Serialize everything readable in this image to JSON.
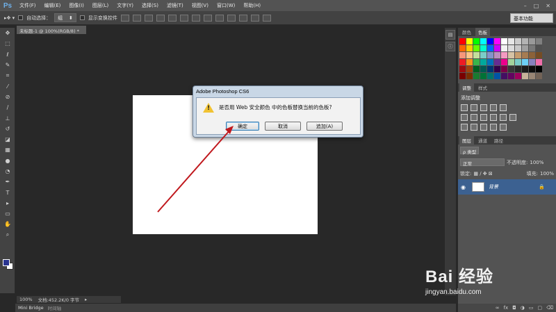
{
  "app": {
    "logo": "Ps"
  },
  "menubar": {
    "items": [
      "文件(F)",
      "编辑(E)",
      "图像(I)",
      "图层(L)",
      "文字(Y)",
      "选择(S)",
      "滤镜(T)",
      "视图(V)",
      "窗口(W)",
      "帮助(H)"
    ],
    "window_controls": [
      "–",
      "□",
      "✕"
    ]
  },
  "options": {
    "auto_select_label": "自动选择：",
    "group_value": "组",
    "show_transform_label": "显示变换控件",
    "workspace": "基本功能"
  },
  "document": {
    "tab_title": "未标题-1 @ 100%(RGB/8) *",
    "zoom": "100%",
    "doc_info": "文档:452.2K/0 字节"
  },
  "bottom_tabs": [
    "Mini Bridge",
    "时间轴"
  ],
  "panels": {
    "color_tabs": [
      "颜色",
      "色板"
    ],
    "adjust_tabs": [
      "调整",
      "样式"
    ],
    "adjust_title": "添加调整",
    "layers_tabs": [
      "图层",
      "通道",
      "路径"
    ],
    "filter_type": "ρ 类型",
    "blend_mode": "正常",
    "opacity_label": "不透明度:",
    "opacity_value": "100%",
    "lock_label": "锁定:",
    "fill_label": "填充:",
    "fill_value": "100%",
    "layer_name": "背景"
  },
  "swatch_colors": [
    "#ff0000",
    "#ffff00",
    "#00ff00",
    "#00ffff",
    "#0000ff",
    "#ff00ff",
    "#ffffff",
    "#e6e6e6",
    "#cccccc",
    "#b3b3b3",
    "#999999",
    "#808080",
    "#ff6600",
    "#ffcc00",
    "#66ff00",
    "#00ffcc",
    "#0066ff",
    "#cc00ff",
    "#f2f2f2",
    "#dcdcdc",
    "#c8c8c8",
    "#a0a0a0",
    "#787878",
    "#505050",
    "#f7977a",
    "#fdc68a",
    "#c4df9b",
    "#7bcdc8",
    "#8493ca",
    "#bc8dbf",
    "#f49ac2",
    "#d6c3a5",
    "#c69c6d",
    "#a67c52",
    "#8c6239",
    "#754c24",
    "#ed1c24",
    "#f7941d",
    "#39b54a",
    "#00a99d",
    "#0072bc",
    "#662d91",
    "#ec008c",
    "#a3d39c",
    "#7accc8",
    "#6dcff6",
    "#8781bd",
    "#f06eaa",
    "#9e0b0f",
    "#a0410d",
    "#005e20",
    "#005952",
    "#003471",
    "#32004b",
    "#7b0046",
    "#363636",
    "#262626",
    "#1a1a1a",
    "#0d0d0d",
    "#000000",
    "#790000",
    "#7b2e00",
    "#197b30",
    "#007236",
    "#00746b",
    "#0054a6",
    "#440e62",
    "#630460",
    "#9e005d",
    "#c7b299",
    "#998675",
    "#736357"
  ],
  "dialog": {
    "title": "Adobe Photoshop CS6",
    "message": "是否用 Web 安全颜色 中的色板替换当前的色板?",
    "buttons": {
      "ok": "确定",
      "cancel": "取消",
      "append": "追加(A)"
    },
    "icon": "warning-icon"
  },
  "watermark": {
    "logo": "Bai 经验",
    "url": "jingyan.baidu.com"
  },
  "annotation": {
    "arrow_color": "#c0181d"
  }
}
